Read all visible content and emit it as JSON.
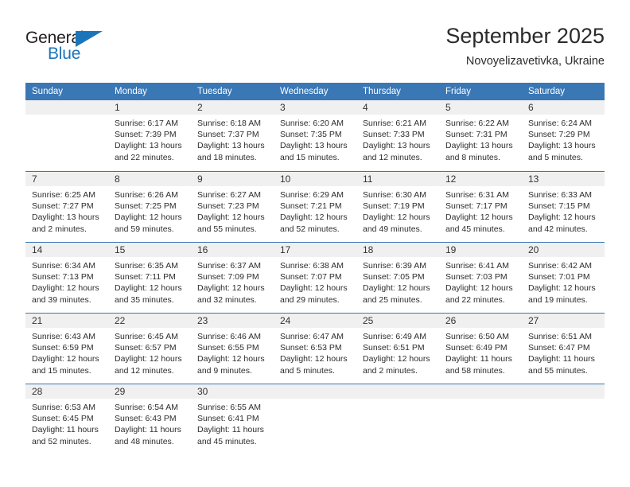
{
  "brand": {
    "name_top": "General",
    "name_bottom": "Blue",
    "accent_color": "#1b75bb",
    "triangle_icon": "brand-triangle-icon"
  },
  "header": {
    "title": "September 2025",
    "subtitle": "Novoyelizavetivka, Ukraine"
  },
  "calendar": {
    "header_bg": "#3a77b5",
    "day_band_bg": "#f0f0f0",
    "weekdays": [
      "Sunday",
      "Monday",
      "Tuesday",
      "Wednesday",
      "Thursday",
      "Friday",
      "Saturday"
    ],
    "weeks": [
      [
        {
          "day": "",
          "lines": []
        },
        {
          "day": "1",
          "lines": [
            "Sunrise: 6:17 AM",
            "Sunset: 7:39 PM",
            "Daylight: 13 hours",
            "and 22 minutes."
          ]
        },
        {
          "day": "2",
          "lines": [
            "Sunrise: 6:18 AM",
            "Sunset: 7:37 PM",
            "Daylight: 13 hours",
            "and 18 minutes."
          ]
        },
        {
          "day": "3",
          "lines": [
            "Sunrise: 6:20 AM",
            "Sunset: 7:35 PM",
            "Daylight: 13 hours",
            "and 15 minutes."
          ]
        },
        {
          "day": "4",
          "lines": [
            "Sunrise: 6:21 AM",
            "Sunset: 7:33 PM",
            "Daylight: 13 hours",
            "and 12 minutes."
          ]
        },
        {
          "day": "5",
          "lines": [
            "Sunrise: 6:22 AM",
            "Sunset: 7:31 PM",
            "Daylight: 13 hours",
            "and 8 minutes."
          ]
        },
        {
          "day": "6",
          "lines": [
            "Sunrise: 6:24 AM",
            "Sunset: 7:29 PM",
            "Daylight: 13 hours",
            "and 5 minutes."
          ]
        }
      ],
      [
        {
          "day": "7",
          "lines": [
            "Sunrise: 6:25 AM",
            "Sunset: 7:27 PM",
            "Daylight: 13 hours",
            "and 2 minutes."
          ]
        },
        {
          "day": "8",
          "lines": [
            "Sunrise: 6:26 AM",
            "Sunset: 7:25 PM",
            "Daylight: 12 hours",
            "and 59 minutes."
          ]
        },
        {
          "day": "9",
          "lines": [
            "Sunrise: 6:27 AM",
            "Sunset: 7:23 PM",
            "Daylight: 12 hours",
            "and 55 minutes."
          ]
        },
        {
          "day": "10",
          "lines": [
            "Sunrise: 6:29 AM",
            "Sunset: 7:21 PM",
            "Daylight: 12 hours",
            "and 52 minutes."
          ]
        },
        {
          "day": "11",
          "lines": [
            "Sunrise: 6:30 AM",
            "Sunset: 7:19 PM",
            "Daylight: 12 hours",
            "and 49 minutes."
          ]
        },
        {
          "day": "12",
          "lines": [
            "Sunrise: 6:31 AM",
            "Sunset: 7:17 PM",
            "Daylight: 12 hours",
            "and 45 minutes."
          ]
        },
        {
          "day": "13",
          "lines": [
            "Sunrise: 6:33 AM",
            "Sunset: 7:15 PM",
            "Daylight: 12 hours",
            "and 42 minutes."
          ]
        }
      ],
      [
        {
          "day": "14",
          "lines": [
            "Sunrise: 6:34 AM",
            "Sunset: 7:13 PM",
            "Daylight: 12 hours",
            "and 39 minutes."
          ]
        },
        {
          "day": "15",
          "lines": [
            "Sunrise: 6:35 AM",
            "Sunset: 7:11 PM",
            "Daylight: 12 hours",
            "and 35 minutes."
          ]
        },
        {
          "day": "16",
          "lines": [
            "Sunrise: 6:37 AM",
            "Sunset: 7:09 PM",
            "Daylight: 12 hours",
            "and 32 minutes."
          ]
        },
        {
          "day": "17",
          "lines": [
            "Sunrise: 6:38 AM",
            "Sunset: 7:07 PM",
            "Daylight: 12 hours",
            "and 29 minutes."
          ]
        },
        {
          "day": "18",
          "lines": [
            "Sunrise: 6:39 AM",
            "Sunset: 7:05 PM",
            "Daylight: 12 hours",
            "and 25 minutes."
          ]
        },
        {
          "day": "19",
          "lines": [
            "Sunrise: 6:41 AM",
            "Sunset: 7:03 PM",
            "Daylight: 12 hours",
            "and 22 minutes."
          ]
        },
        {
          "day": "20",
          "lines": [
            "Sunrise: 6:42 AM",
            "Sunset: 7:01 PM",
            "Daylight: 12 hours",
            "and 19 minutes."
          ]
        }
      ],
      [
        {
          "day": "21",
          "lines": [
            "Sunrise: 6:43 AM",
            "Sunset: 6:59 PM",
            "Daylight: 12 hours",
            "and 15 minutes."
          ]
        },
        {
          "day": "22",
          "lines": [
            "Sunrise: 6:45 AM",
            "Sunset: 6:57 PM",
            "Daylight: 12 hours",
            "and 12 minutes."
          ]
        },
        {
          "day": "23",
          "lines": [
            "Sunrise: 6:46 AM",
            "Sunset: 6:55 PM",
            "Daylight: 12 hours",
            "and 9 minutes."
          ]
        },
        {
          "day": "24",
          "lines": [
            "Sunrise: 6:47 AM",
            "Sunset: 6:53 PM",
            "Daylight: 12 hours",
            "and 5 minutes."
          ]
        },
        {
          "day": "25",
          "lines": [
            "Sunrise: 6:49 AM",
            "Sunset: 6:51 PM",
            "Daylight: 12 hours",
            "and 2 minutes."
          ]
        },
        {
          "day": "26",
          "lines": [
            "Sunrise: 6:50 AM",
            "Sunset: 6:49 PM",
            "Daylight: 11 hours",
            "and 58 minutes."
          ]
        },
        {
          "day": "27",
          "lines": [
            "Sunrise: 6:51 AM",
            "Sunset: 6:47 PM",
            "Daylight: 11 hours",
            "and 55 minutes."
          ]
        }
      ],
      [
        {
          "day": "28",
          "lines": [
            "Sunrise: 6:53 AM",
            "Sunset: 6:45 PM",
            "Daylight: 11 hours",
            "and 52 minutes."
          ]
        },
        {
          "day": "29",
          "lines": [
            "Sunrise: 6:54 AM",
            "Sunset: 6:43 PM",
            "Daylight: 11 hours",
            "and 48 minutes."
          ]
        },
        {
          "day": "30",
          "lines": [
            "Sunrise: 6:55 AM",
            "Sunset: 6:41 PM",
            "Daylight: 11 hours",
            "and 45 minutes."
          ]
        },
        {
          "day": "",
          "lines": []
        },
        {
          "day": "",
          "lines": []
        },
        {
          "day": "",
          "lines": []
        },
        {
          "day": "",
          "lines": []
        }
      ]
    ]
  }
}
